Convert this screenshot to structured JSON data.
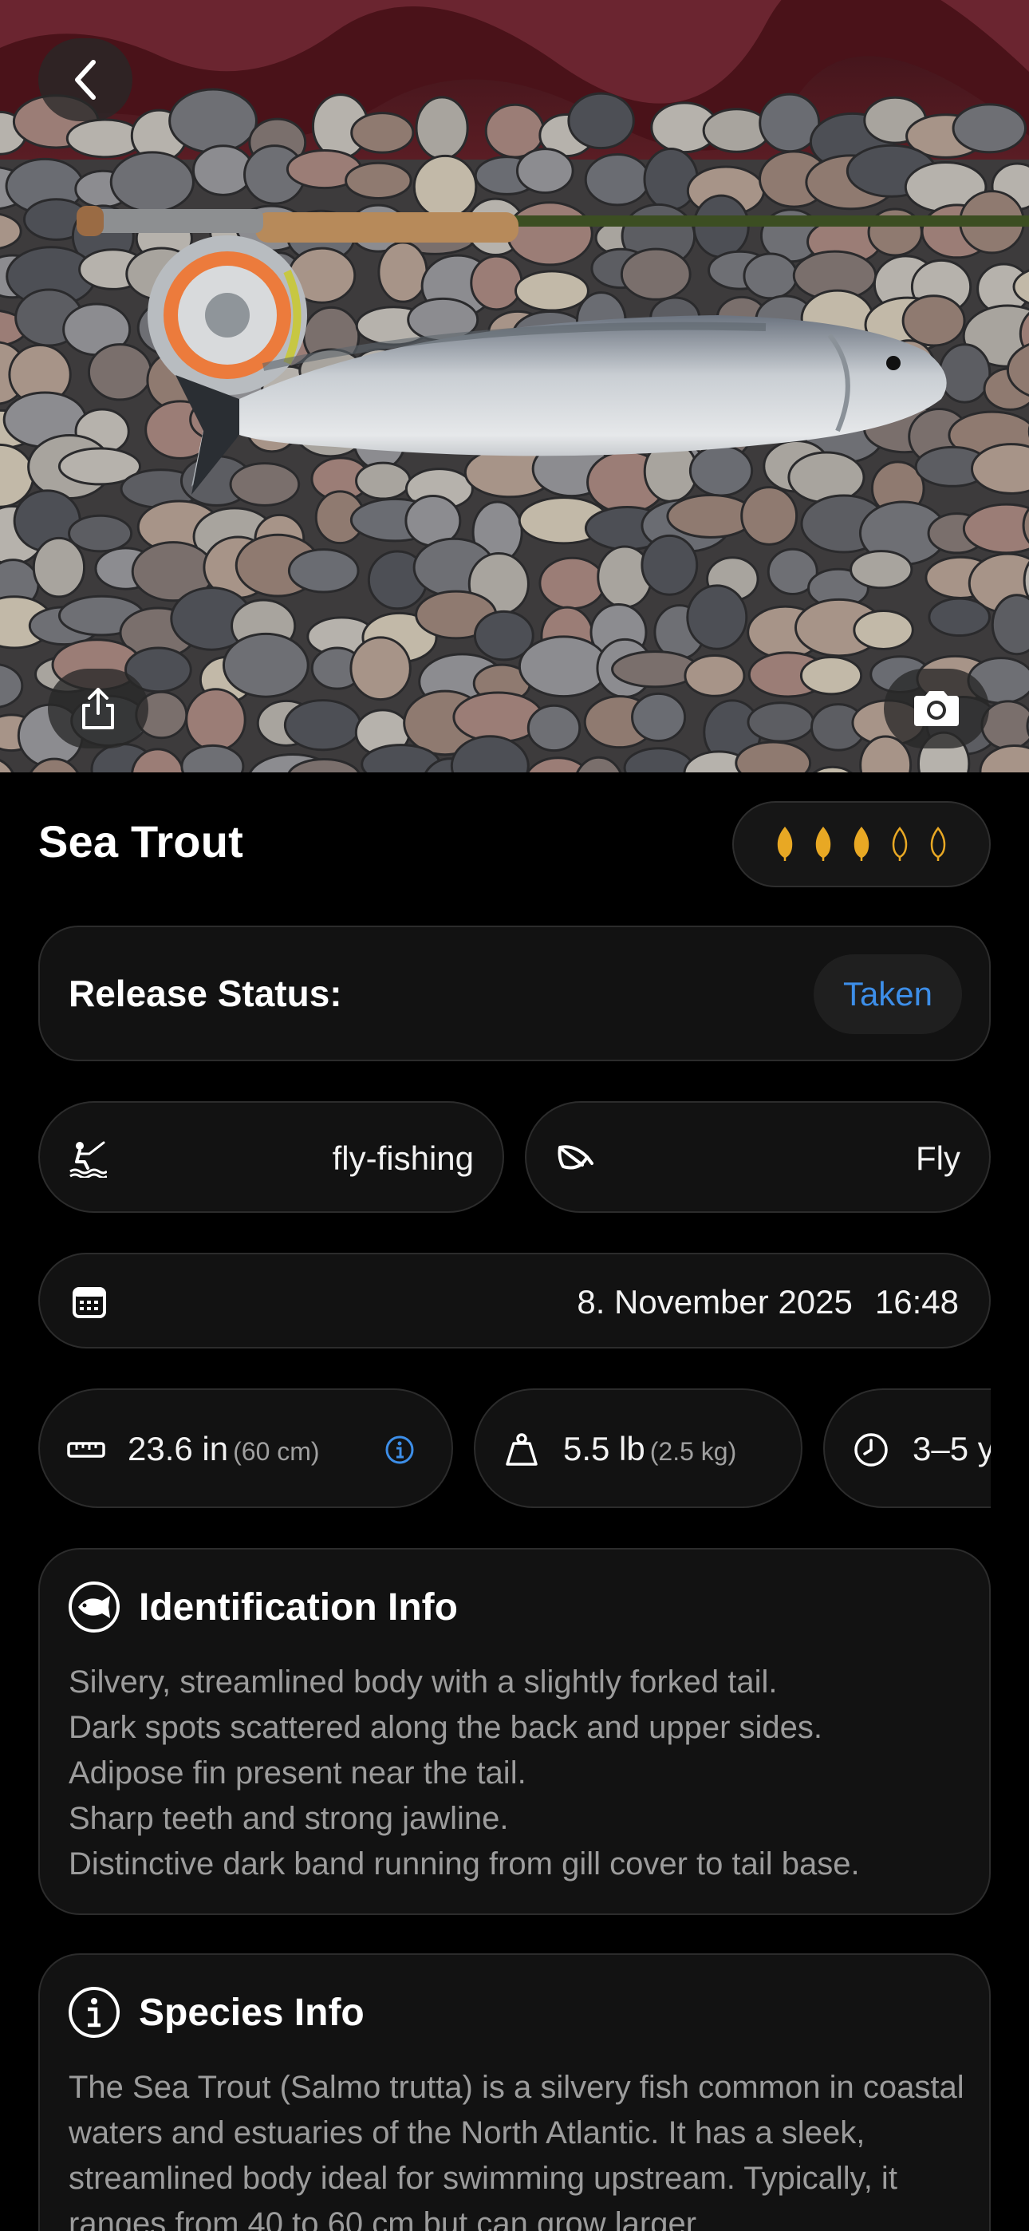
{
  "nav": {
    "back_icon": "chevron-left-icon",
    "share_icon": "share-icon",
    "camera_icon": "camera-icon"
  },
  "catch": {
    "species_name": "Sea Trout",
    "rating": {
      "filled": 3,
      "total": 5,
      "color": "#e8a824"
    }
  },
  "release": {
    "label": "Release Status:",
    "value": "Taken",
    "value_color": "#3d8ee8"
  },
  "method": {
    "icon": "fisherman-icon",
    "value": "fly-fishing"
  },
  "bait": {
    "icon": "fly-lure-icon",
    "value": "Fly"
  },
  "date": {
    "icon": "calendar-icon",
    "date": "8. November 2025",
    "time": "16:48"
  },
  "stats": {
    "length": {
      "icon": "ruler-icon",
      "value": "23.6 in",
      "metric": "(60 cm)",
      "info_icon": "info-icon"
    },
    "weight": {
      "icon": "weight-icon",
      "value": "5.5 lb",
      "metric": "(2.5 kg)"
    },
    "age": {
      "icon": "clock-icon",
      "value": "3–5 y"
    }
  },
  "identification": {
    "icon": "fish-badge-icon",
    "title": "Identification Info",
    "lines": [
      "Silvery, streamlined body with a slightly forked tail.",
      "Dark spots scattered along the back and upper sides.",
      "Adipose fin present near the tail.",
      "Sharp teeth and strong jawline.",
      "Distinctive dark band running from gill cover to tail base."
    ]
  },
  "species_info": {
    "icon": "info-circle-icon",
    "title": "Species Info",
    "text": "The Sea Trout (Salmo trutta) is a silvery fish common in coastal waters and estuaries of the North Atlantic. It has a sleek, streamlined body ideal for swimming upstream. Typically, it ranges from 40 to 60 cm but can grow larger"
  }
}
